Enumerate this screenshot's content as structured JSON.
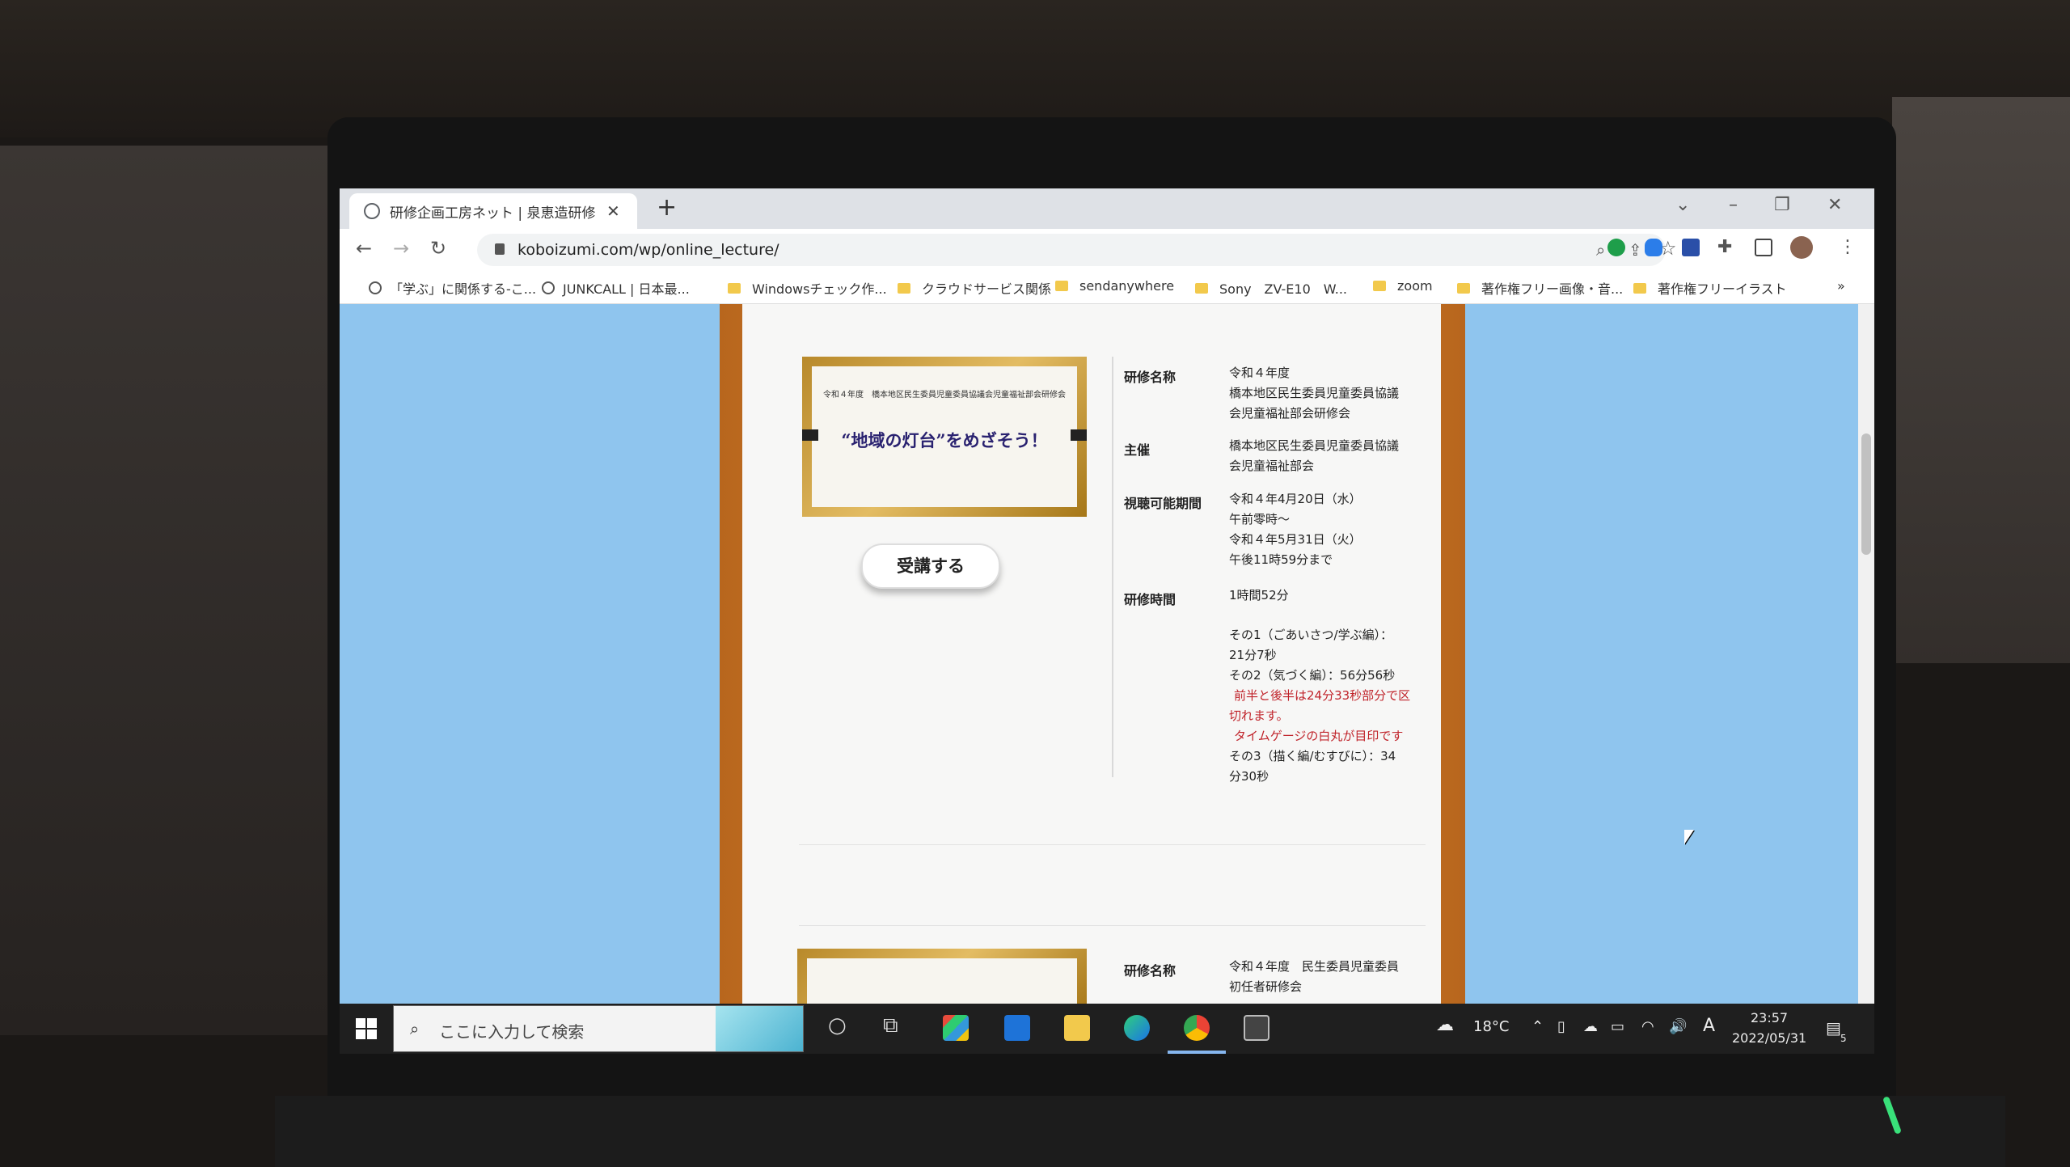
{
  "browser": {
    "tab_title": "研修企画工房ネット | 泉恵造研修",
    "url": "koboizumi.com/wp/online_lecture/",
    "bookmarks": [
      "「学ぶ」に関係する-こ...",
      "JUNKCALL | 日本最...",
      "Windowsチェック作...",
      "クラウドサービス関係",
      "sendanywhere",
      "Sony　ZV-E10　W...",
      "zoom",
      "著作権フリー画像・音...",
      "著作権フリーイラスト"
    ],
    "bookmarks_overflow": "»"
  },
  "lecture1": {
    "thumb_small": "令和４年度　橋本地区民生委員児童委員協議会児童福祉部会研修会",
    "thumb_title": "“地域の灯台”をめざそう！",
    "button": "受講する",
    "labels": {
      "name": "研修名称",
      "host": "主催",
      "period": "視聴可能期間",
      "duration": "研修時間"
    },
    "name": [
      "令和４年度",
      "橋本地区民生委員児童委員協議",
      "会児童福祉部会研修会"
    ],
    "host": [
      "橋本地区民生委員児童委員協議",
      "会児童福祉部会"
    ],
    "period": [
      "令和４年4月20日（水）",
      "午前零時～",
      "令和４年5月31日（火）",
      "午後11時59分まで"
    ],
    "duration": "1時間52分",
    "parts": {
      "p1a": "その1（ごあいさつ/学ぶ編）：",
      "p1b": "21分7秒",
      "p2": "その2（気づく編）：56分56秒",
      "note1a": "前半と後半は24分33秒部分で区",
      "note1b": "切れます。",
      "note2": "タイムゲージの白丸が目印です",
      "p3a": "その3（描く編/むすびに）：34",
      "p3b": "分30秒"
    }
  },
  "lecture2": {
    "label": "研修名称",
    "name": [
      "令和４年度　民生委員児童委員",
      "初任者研修会"
    ]
  },
  "taskbar": {
    "search_placeholder": "ここに入力して検索",
    "weather": "18°C",
    "ime": "A",
    "time": "23:57",
    "date": "2022/05/31",
    "notifications": "5"
  }
}
